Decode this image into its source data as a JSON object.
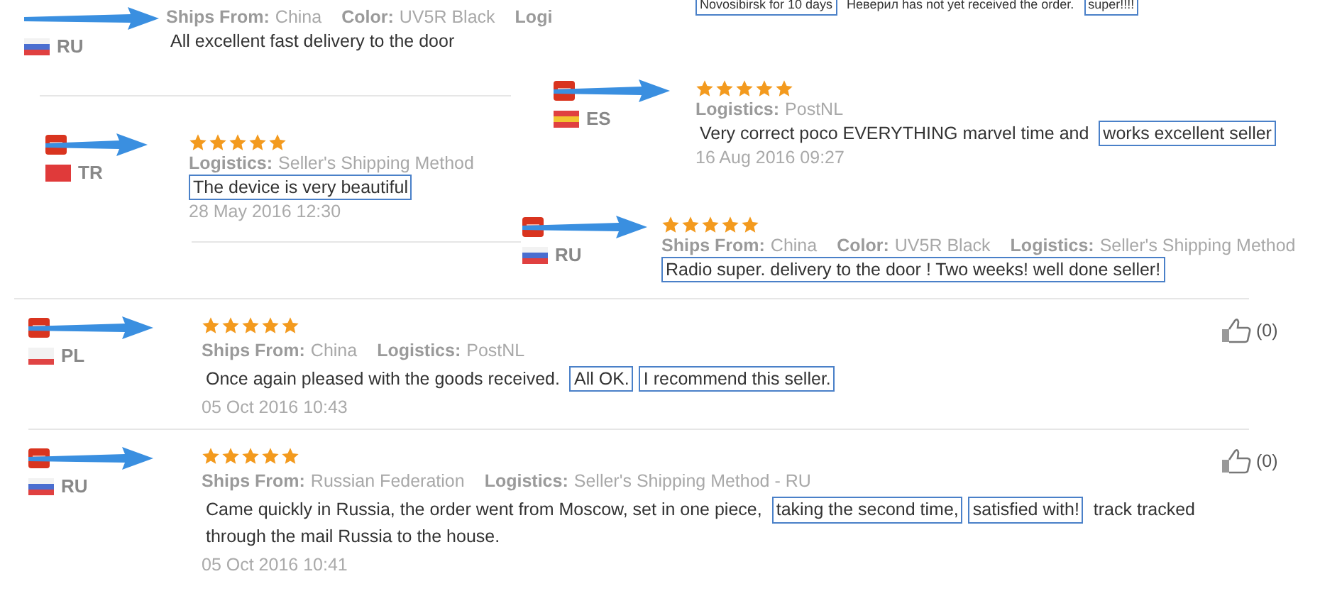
{
  "fragments": [
    {
      "comment": [
        {
          "text": "Novosibirsk for 10 days",
          "boxed": true
        },
        {
          "text": "Неверил has not yet received the order.",
          "boxed": false
        },
        {
          "text": "super!!!!",
          "boxed": true
        }
      ]
    },
    {
      "country": "RU",
      "meta": [
        {
          "label": "Ships From:",
          "value": "China"
        },
        {
          "label": "Color:",
          "value": "UV5R Black"
        },
        {
          "label": "Logi"
        }
      ],
      "comment": [
        {
          "text": "All excellent fast delivery to the door",
          "boxed": false
        }
      ]
    },
    {
      "country": "ES",
      "stars": 5,
      "meta": [
        {
          "label": "Logistics:",
          "value": "PostNL"
        }
      ],
      "comment": [
        {
          "text": "Very correct poco EVERYTHING marvel time and",
          "boxed": false
        },
        {
          "text": "works excellent seller",
          "boxed": true
        }
      ],
      "date": "16 Aug 2016 09:27"
    },
    {
      "country": "TR",
      "stars": 5,
      "meta": [
        {
          "label": "Logistics:",
          "value": "Seller's Shipping Method"
        }
      ],
      "comment": [
        {
          "text": "The device is very beautiful",
          "boxed": true
        }
      ],
      "date": "28 May 2016 12:30"
    },
    {
      "country": "RU",
      "stars": 5,
      "meta": [
        {
          "label": "Ships From:",
          "value": "China"
        },
        {
          "label": "Color:",
          "value": "UV5R Black"
        },
        {
          "label": "Logistics:",
          "value": "Seller's Shipping Method"
        }
      ],
      "comment": [
        {
          "text": "Radio super. delivery to the door ! Two weeks! well done seller!",
          "boxed": true
        }
      ]
    }
  ],
  "reviews": [
    {
      "country": "PL",
      "stars": 5,
      "meta": [
        {
          "label": "Ships From:",
          "value": "China"
        },
        {
          "label": "Logistics:",
          "value": "PostNL"
        }
      ],
      "comment": [
        {
          "text": "Once again pleased with the goods received.",
          "boxed": false
        },
        {
          "text": "All OK.",
          "boxed": true
        },
        {
          "text": "I recommend this seller.",
          "boxed": true
        }
      ],
      "date": "05 Oct 2016 10:43",
      "likes": "(0)"
    },
    {
      "country": "RU",
      "stars": 5,
      "meta": [
        {
          "label": "Ships From:",
          "value": "Russian Federation"
        },
        {
          "label": "Logistics:",
          "value": "Seller's Shipping Method - RU"
        }
      ],
      "comment": [
        {
          "text": "Came quickly in Russia, the order went from Moscow, set in one piece,",
          "boxed": false
        },
        {
          "text": "taking the second time,",
          "boxed": true
        },
        {
          "text": "satisfied with!",
          "boxed": true
        },
        {
          "text": "track tracked",
          "boxed": false
        },
        {
          "text": "through the mail Russia to the house.",
          "boxed": false
        }
      ],
      "date": "05 Oct 2016 10:41",
      "likes": "(0)"
    }
  ]
}
